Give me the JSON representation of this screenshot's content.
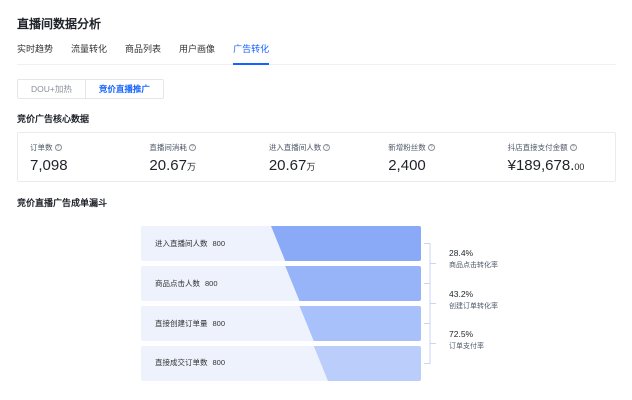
{
  "page": {
    "title": "直播间数据分析"
  },
  "tabs": [
    {
      "label": "实时趋势",
      "active": false
    },
    {
      "label": "流量转化",
      "active": false
    },
    {
      "label": "商品列表",
      "active": false
    },
    {
      "label": "用户画像",
      "active": false
    },
    {
      "label": "广告转化",
      "active": true
    }
  ],
  "segments": [
    {
      "label": "DOU+加热",
      "active": false
    },
    {
      "label": "竞价直播推广",
      "active": true
    }
  ],
  "core": {
    "title": "竞价广告核心数据",
    "metrics": [
      {
        "label": "订单数",
        "value": "7,098",
        "suffix": ""
      },
      {
        "label": "直播间消耗",
        "value": "20.67",
        "suffix": "万"
      },
      {
        "label": "进入直播间人数",
        "value": "20.67",
        "suffix": "万"
      },
      {
        "label": "新增粉丝数",
        "value": "2,400",
        "suffix": ""
      },
      {
        "label": "抖店直接支付金额",
        "value": "¥189,678.",
        "suffix": "00"
      }
    ]
  },
  "funnel": {
    "title": "竞价直播广告成单漏斗",
    "stages": [
      {
        "label": "进入直播间人数",
        "value": "800",
        "fill": 1.0,
        "color": "#8aa9f7"
      },
      {
        "label": "商品点击人数",
        "value": "800",
        "fill": 0.905,
        "color": "#97b4f8"
      },
      {
        "label": "直接创建订单量",
        "value": "800",
        "fill": 0.81,
        "color": "#a8c1fa"
      },
      {
        "label": "直接成交订单数",
        "value": "800",
        "fill": 0.715,
        "color": "#bbcefb"
      }
    ],
    "conversions": [
      {
        "pct": "28.4%",
        "label": "商品点击转化率"
      },
      {
        "pct": "43.2%",
        "label": "创建订单转化率"
      },
      {
        "pct": "72.5%",
        "label": "订单支付率"
      }
    ],
    "bar_bg": "#eef2fd",
    "bracket_color": "#c9d6f3"
  }
}
